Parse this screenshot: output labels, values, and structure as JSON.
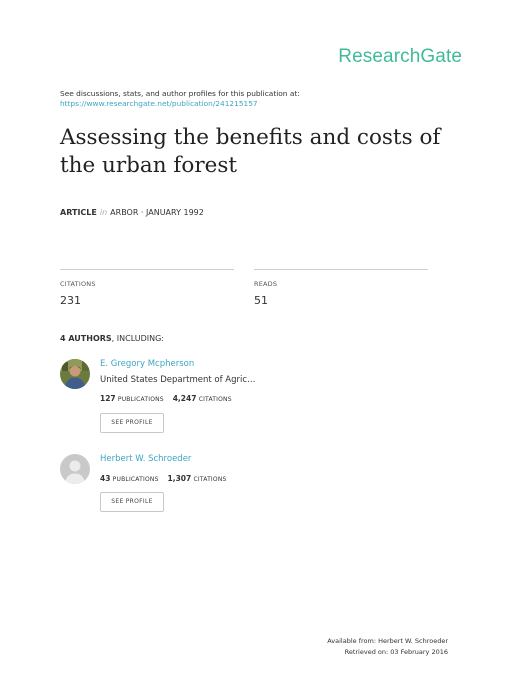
{
  "brand": "ResearchGate",
  "header": {
    "discuss_text": "See discussions, stats, and author profiles for this publication at:",
    "publication_url": "https://www.researchgate.net/publication/241215157"
  },
  "title": "Assessing the benefits and costs of the urban forest",
  "meta": {
    "type_label": "ARTICLE",
    "in_word": "in",
    "journal_date": "ARBOR · JANUARY 1992"
  },
  "stats": {
    "citations_label": "CITATIONS",
    "citations_value": "231",
    "reads_label": "READS",
    "reads_value": "51"
  },
  "authors": {
    "count_label": "4 AUTHORS",
    "including": ", INCLUDING:",
    "list": [
      {
        "name": "E. Gregory Mcpherson",
        "institution": "United States Department of Agric…",
        "publications": "127",
        "publications_label": "PUBLICATIONS",
        "citations": "4,247",
        "citations_label": "CITATIONS",
        "button_label": "SEE PROFILE",
        "avatar_icon": "author-photo"
      },
      {
        "name": "Herbert W. Schroeder",
        "publications": "43",
        "publications_label": "PUBLICATIONS",
        "citations": "1,307",
        "citations_label": "CITATIONS",
        "button_label": "SEE PROFILE",
        "avatar_icon": "default-user-icon"
      }
    ]
  },
  "footer": {
    "available_from": "Available from: Herbert W. Schroeder",
    "retrieved_on": "Retrieved on: 03 February 2016"
  },
  "colors": {
    "brand": "#40ba9b",
    "link": "#3da5c4"
  }
}
